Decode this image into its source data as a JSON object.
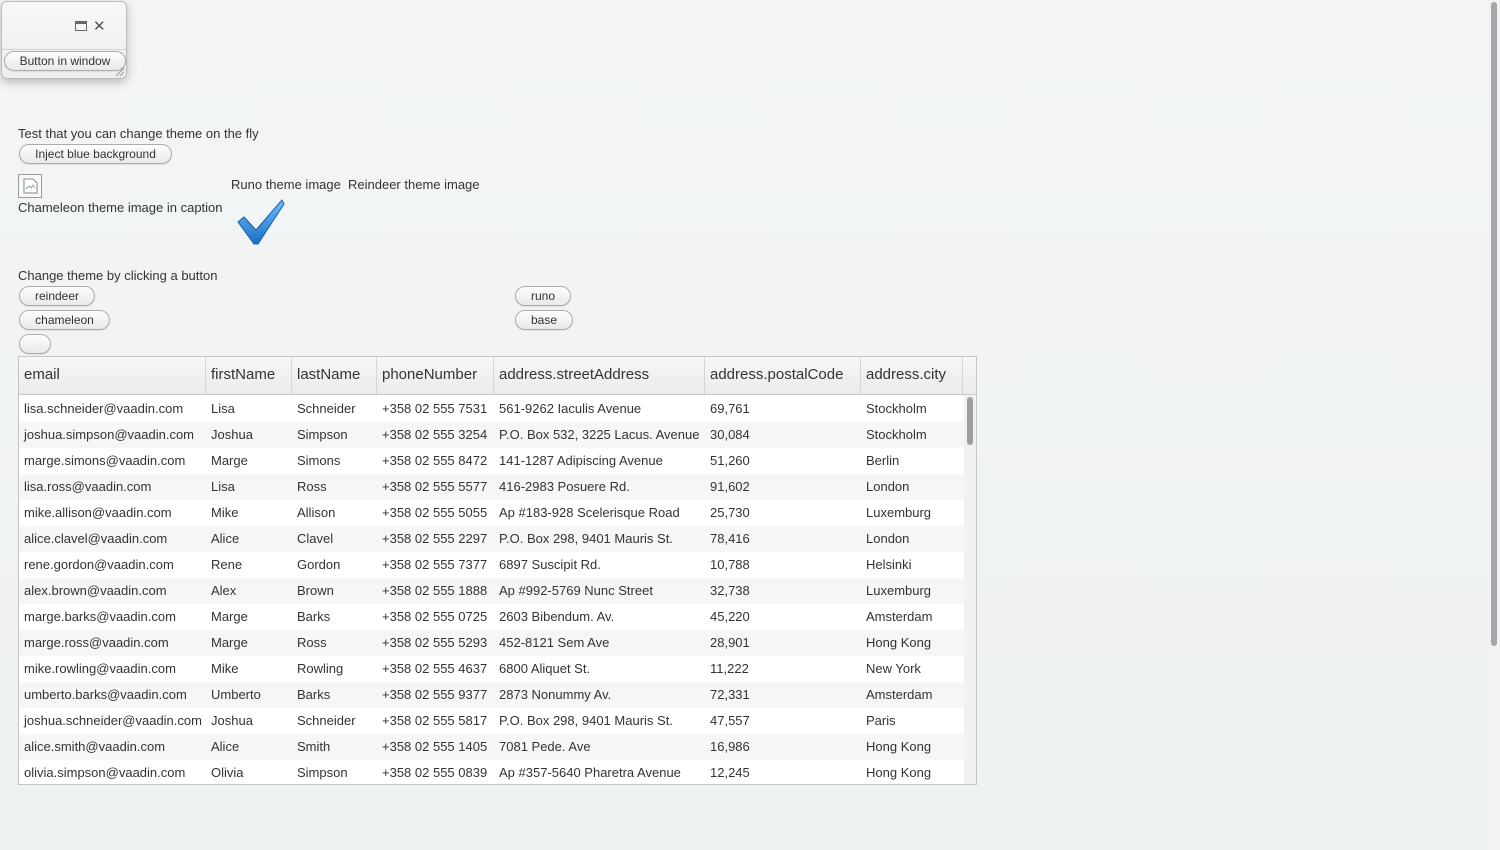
{
  "window": {
    "button_label": "Button in window"
  },
  "intro": {
    "caption": "Test that you can change theme on the fly",
    "inject_button": "Inject blue background"
  },
  "images": {
    "chameleon_caption": "Chameleon theme image in caption",
    "runo_caption": "Runo theme image",
    "reindeer_caption": "Reindeer theme image"
  },
  "theme_switch": {
    "caption": "Change theme by clicking a button",
    "buttons": {
      "reindeer": "reindeer",
      "runo": "runo",
      "chameleon": "chameleon",
      "base": "base",
      "empty": ""
    }
  },
  "table": {
    "columns": [
      "email",
      "firstName",
      "lastName",
      "phoneNumber",
      "address.streetAddress",
      "address.postalCode",
      "address.city"
    ],
    "rows": [
      [
        "lisa.schneider@vaadin.com",
        "Lisa",
        "Schneider",
        "+358 02 555 7531",
        "561-9262 Iaculis Avenue",
        "69,761",
        "Stockholm"
      ],
      [
        "joshua.simpson@vaadin.com",
        "Joshua",
        "Simpson",
        "+358 02 555 3254",
        "P.O. Box 532, 3225 Lacus. Avenue",
        "30,084",
        "Stockholm"
      ],
      [
        "marge.simons@vaadin.com",
        "Marge",
        "Simons",
        "+358 02 555 8472",
        "141-1287 Adipiscing Avenue",
        "51,260",
        "Berlin"
      ],
      [
        "lisa.ross@vaadin.com",
        "Lisa",
        "Ross",
        "+358 02 555 5577",
        "416-2983 Posuere Rd.",
        "91,602",
        "London"
      ],
      [
        "mike.allison@vaadin.com",
        "Mike",
        "Allison",
        "+358 02 555 5055",
        "Ap #183-928 Scelerisque Road",
        "25,730",
        "Luxemburg"
      ],
      [
        "alice.clavel@vaadin.com",
        "Alice",
        "Clavel",
        "+358 02 555 2297",
        "P.O. Box 298, 9401 Mauris St.",
        "78,416",
        "London"
      ],
      [
        "rene.gordon@vaadin.com",
        "Rene",
        "Gordon",
        "+358 02 555 7377",
        "6897 Suscipit Rd.",
        "10,788",
        "Helsinki"
      ],
      [
        "alex.brown@vaadin.com",
        "Alex",
        "Brown",
        "+358 02 555 1888",
        "Ap #992-5769 Nunc Street",
        "32,738",
        "Luxemburg"
      ],
      [
        "marge.barks@vaadin.com",
        "Marge",
        "Barks",
        "+358 02 555 0725",
        "2603 Bibendum. Av.",
        "45,220",
        "Amsterdam"
      ],
      [
        "marge.ross@vaadin.com",
        "Marge",
        "Ross",
        "+358 02 555 5293",
        "452-8121 Sem Ave",
        "28,901",
        "Hong Kong"
      ],
      [
        "mike.rowling@vaadin.com",
        "Mike",
        "Rowling",
        "+358 02 555 4637",
        "6800 Aliquet St.",
        "11,222",
        "New York"
      ],
      [
        "umberto.barks@vaadin.com",
        "Umberto",
        "Barks",
        "+358 02 555 9377",
        "2873 Nonummy Av.",
        "72,331",
        "Amsterdam"
      ],
      [
        "joshua.schneider@vaadin.com",
        "Joshua",
        "Schneider",
        "+358 02 555 5817",
        "P.O. Box 298, 9401 Mauris St.",
        "47,557",
        "Paris"
      ],
      [
        "alice.smith@vaadin.com",
        "Alice",
        "Smith",
        "+358 02 555 1405",
        "7081 Pede. Ave",
        "16,986",
        "Hong Kong"
      ],
      [
        "olivia.simpson@vaadin.com",
        "Olivia",
        "Simpson",
        "+358 02 555 0839",
        "Ap #357-5640 Pharetra Avenue",
        "12,245",
        "Hong Kong"
      ]
    ]
  },
  "colors": {
    "checkmark": "#2f8fe0",
    "row_alt": "#f5f6f6"
  },
  "icons": {
    "window_maximize": "maximize-icon",
    "window_close": "close-icon",
    "broken_image": "broken-image-icon",
    "runo_image": "checkmark-icon"
  }
}
